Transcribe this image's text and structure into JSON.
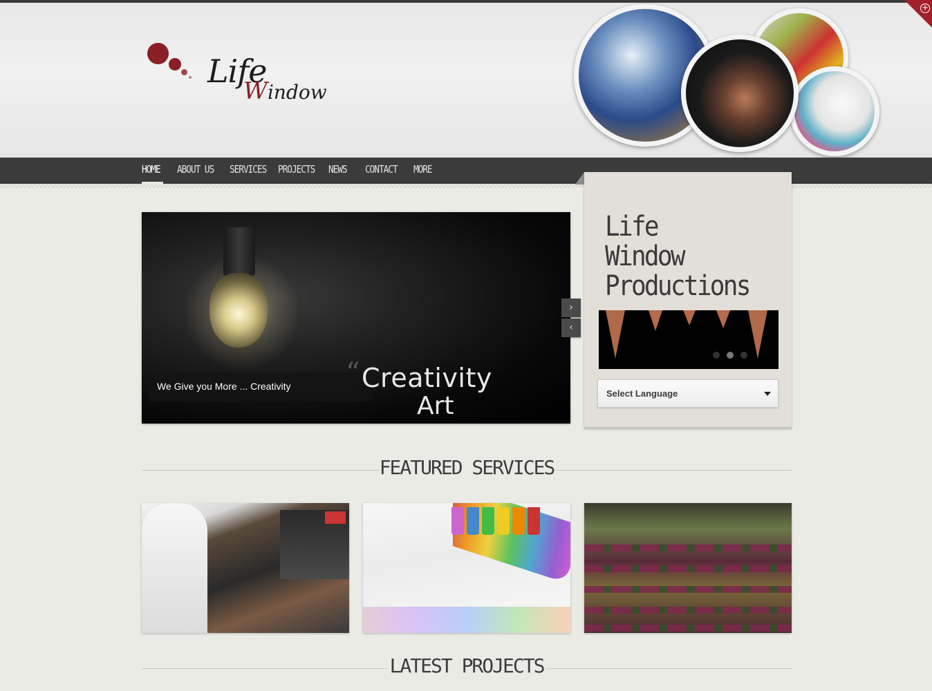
{
  "nav": {
    "items": [
      {
        "label": "HOME",
        "active": true
      },
      {
        "label": "ABOUT US",
        "active": false
      },
      {
        "label": "SERVICES",
        "active": false
      },
      {
        "label": "PROJECTS",
        "active": false
      },
      {
        "label": "NEWS",
        "active": false
      },
      {
        "label": "CONTACT",
        "active": false
      },
      {
        "label": "MORE",
        "active": false
      }
    ]
  },
  "logo": {
    "line1": "Life",
    "line2_initial": "W",
    "line2_rest": "indow"
  },
  "slider": {
    "caption": "We Give you More ... Creativity",
    "quote_mark": "“",
    "word1": "Creativity",
    "word2": "Art",
    "next_icon": "›",
    "prev_icon": "‹"
  },
  "sidebar": {
    "title_lines": [
      "Life",
      "Window",
      "Productions"
    ],
    "slides_total": 3,
    "active_slide": 2,
    "language_select": "Select Language"
  },
  "sections": {
    "featured": "FEATURED SERVICES",
    "latest": "LATEST PROJECTS"
  },
  "corner": {
    "icon": "+"
  },
  "colors": {
    "accent": "#8a1f24",
    "nav_bg": "#3b3b3b",
    "page_bg": "#ebebe6"
  }
}
